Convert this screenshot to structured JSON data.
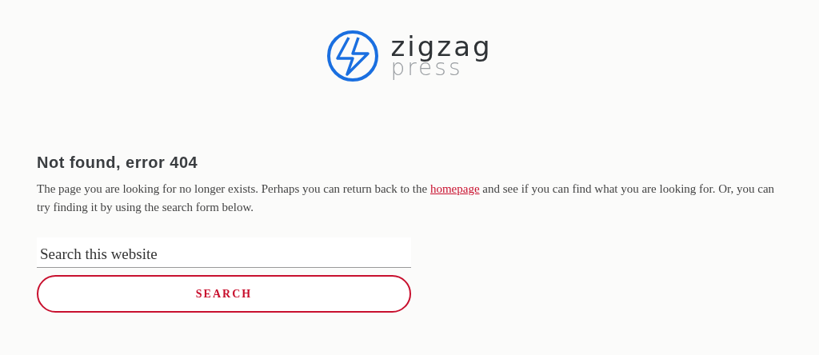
{
  "logo": {
    "name": "zigzag",
    "tagline": "press"
  },
  "heading": "Not found, error 404",
  "message": {
    "before": "The page you are looking for no longer exists. Perhaps you can return back to the ",
    "link": "homepage",
    "after": " and see if you can find what you are looking for. Or, you can try finding it by using the search form below."
  },
  "search": {
    "placeholder": "Search this website",
    "button": "SEARCH"
  }
}
